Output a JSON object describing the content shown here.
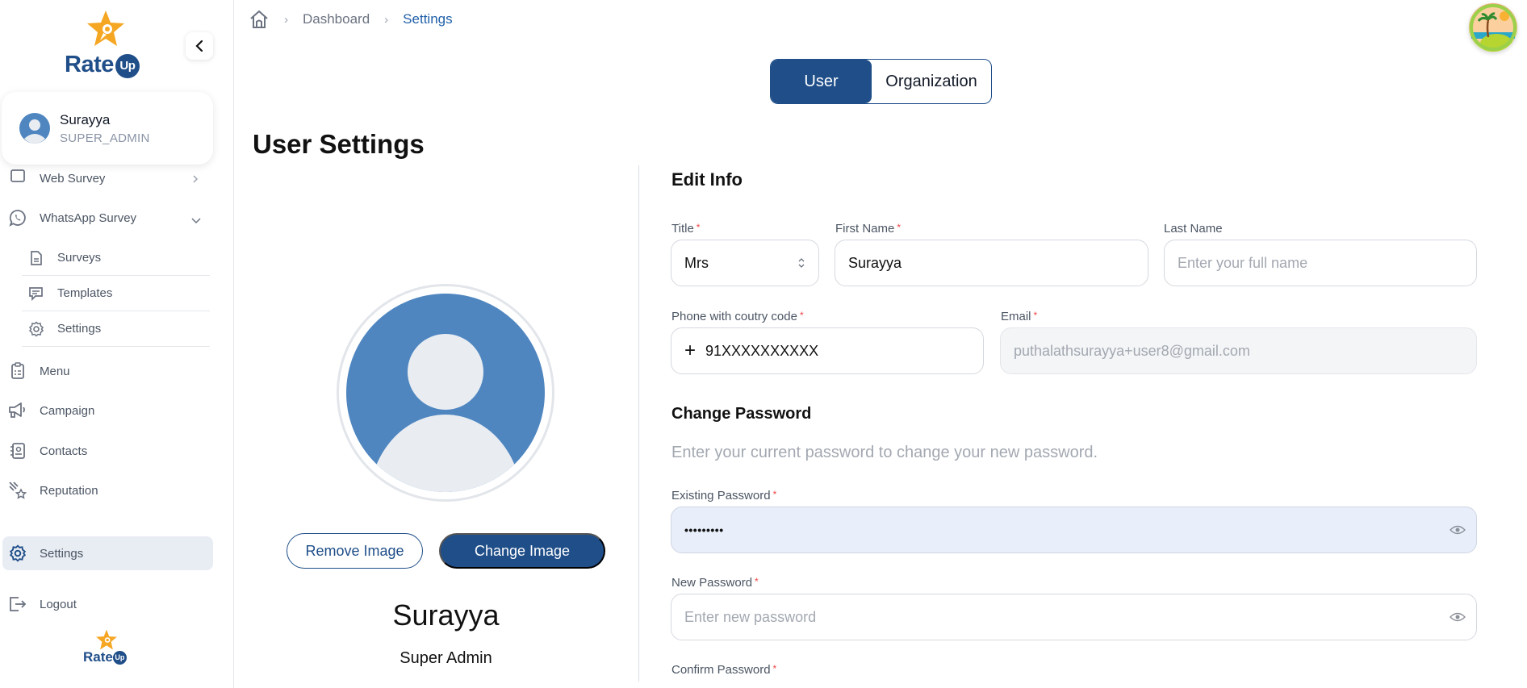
{
  "brand": {
    "name": "Rate",
    "badge": "Up"
  },
  "sidebar": {
    "user": {
      "name": "Surayya",
      "role": "SUPER_ADMIN"
    },
    "items": [
      {
        "label": "Web Survey",
        "icon": "web-survey-icon"
      },
      {
        "label": "WhatsApp Survey",
        "icon": "whatsapp-icon",
        "expanded": true
      },
      {
        "label": "Menu",
        "icon": "clipboard-icon"
      },
      {
        "label": "Campaign",
        "icon": "megaphone-icon"
      },
      {
        "label": "Contacts",
        "icon": "contacts-book-icon"
      },
      {
        "label": "Reputation",
        "icon": "shooting-star-icon"
      },
      {
        "label": "Settings",
        "icon": "gear-icon",
        "active": true
      },
      {
        "label": "Logout",
        "icon": "logout-icon"
      }
    ],
    "sub_items": [
      {
        "label": "Surveys",
        "icon": "document-icon"
      },
      {
        "label": "Templates",
        "icon": "template-chat-icon"
      },
      {
        "label": "Settings",
        "icon": "gear-icon"
      }
    ]
  },
  "breadcrumb": [
    {
      "label": "Dashboard"
    },
    {
      "label": "Settings",
      "current": true
    }
  ],
  "tabs": [
    {
      "label": "User",
      "active": true
    },
    {
      "label": "Organization",
      "active": false
    }
  ],
  "page": {
    "title": "User Settings",
    "profile": {
      "remove_label": "Remove Image",
      "change_label": "Change Image",
      "name": "Surayya",
      "role": "Super Admin"
    },
    "edit_info": {
      "heading": "Edit Info",
      "title": {
        "label": "Title",
        "required": true,
        "value": "Mrs"
      },
      "first_name": {
        "label": "First Name",
        "required": true,
        "value": "Surayya"
      },
      "last_name": {
        "label": "Last Name",
        "required": false,
        "value": "",
        "placeholder": "Enter your full name"
      },
      "phone": {
        "label": "Phone with coutry code",
        "required": true,
        "prefix": "+",
        "value": "91XXXXXXXXXX"
      },
      "email": {
        "label": "Email",
        "required": true,
        "value": "puthalathsurayya+user8@gmail.com",
        "disabled": true
      }
    },
    "change_password": {
      "heading": "Change Password",
      "hint": "Enter your current password to change your new password.",
      "existing": {
        "label": "Existing Password",
        "required": true,
        "value": "•••••••••"
      },
      "new": {
        "label": "New Password",
        "required": true,
        "value": "",
        "placeholder": "Enter new password"
      },
      "confirm": {
        "label": "Confirm Password",
        "required": true
      }
    }
  },
  "colors": {
    "primary": "#1f4e89",
    "active_bg": "#e8ecf3",
    "accent_star": "#f5a623",
    "required": "#ef4444",
    "avatar_blue": "#4f86c0"
  }
}
